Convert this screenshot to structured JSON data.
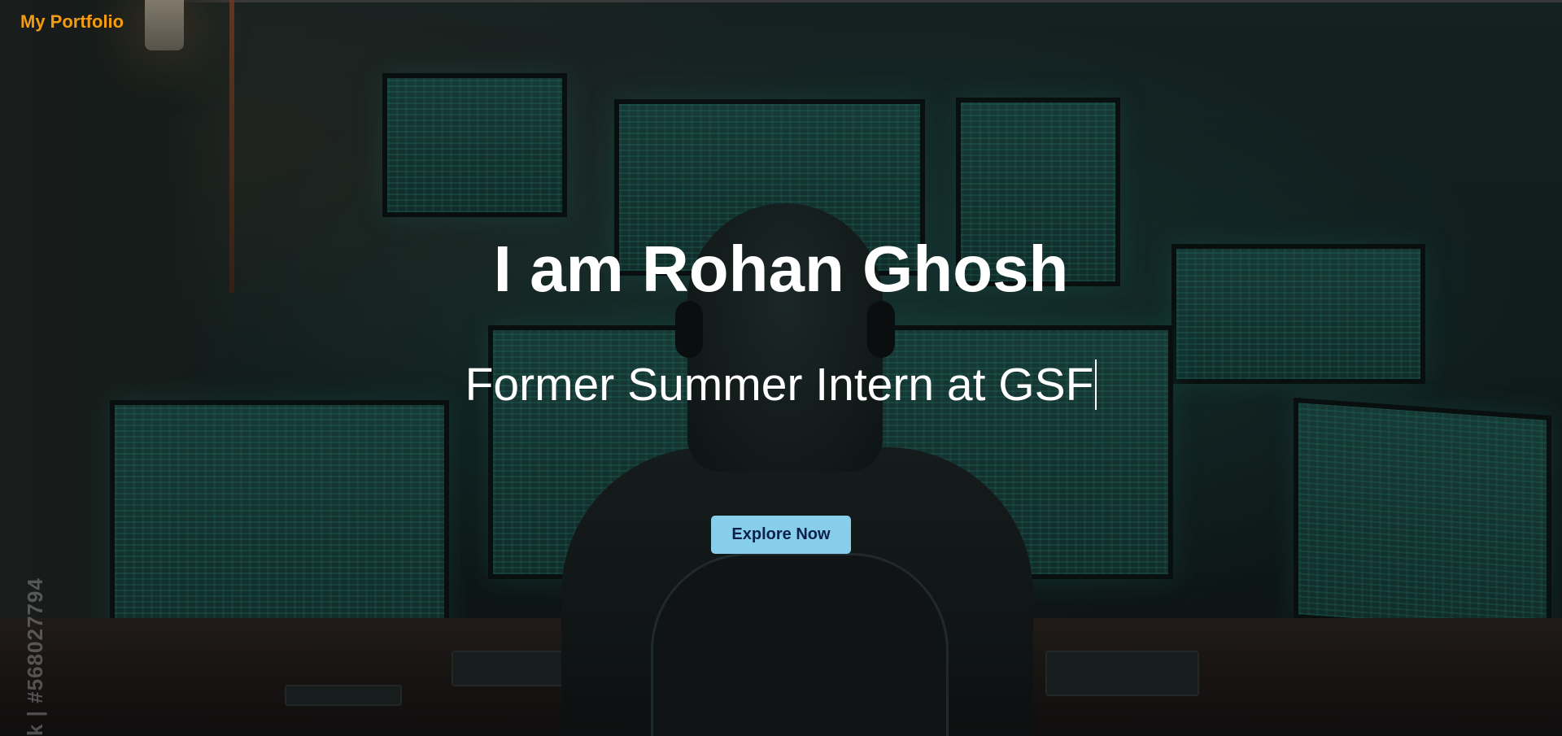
{
  "header": {
    "brand_label": "My Portfolio"
  },
  "hero": {
    "title": "I am Rohan Ghosh",
    "subtitle": "Former Summer Intern at GSF",
    "cta_label": "Explore Now"
  },
  "background": {
    "watermark_text": "k | #568027794"
  },
  "colors": {
    "brand": "#f39c12",
    "cta_background": "#87ceeb",
    "cta_text": "#0d1f4f",
    "hero_text": "#ffffff"
  }
}
